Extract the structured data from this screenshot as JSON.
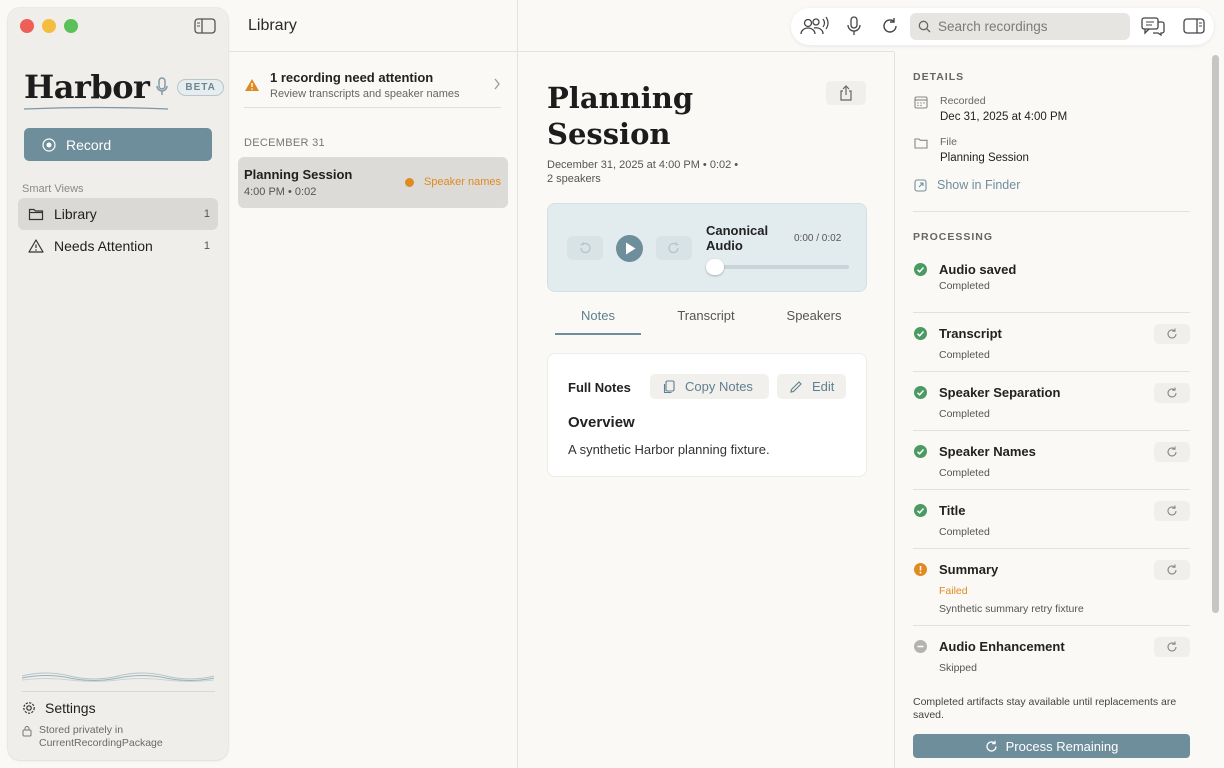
{
  "window": {
    "colors": {
      "accent": "#6f8e9c",
      "warning": "#e08a22",
      "success": "#4a9a62"
    }
  },
  "sidebar": {
    "brand": "Harbor",
    "beta": "BETA",
    "record_label": "Record",
    "section_label": "Smart Views",
    "items": [
      {
        "label": "Library",
        "count": "1",
        "icon": "folder-icon"
      },
      {
        "label": "Needs Attention",
        "count": "1",
        "icon": "warning-triangle-icon"
      }
    ],
    "settings_label": "Settings",
    "stored_line1": "Stored privately in",
    "stored_line2": "CurrentRecordingPackage"
  },
  "list": {
    "title": "Library",
    "alert_title": "1 recording need attention",
    "alert_sub": "Review transcripts and speaker names",
    "date_heading": "DECEMBER 31",
    "recording": {
      "title": "Planning Session",
      "meta": "4:00 PM  •  0:02",
      "badge": "Speaker names"
    }
  },
  "toolbar": {
    "search_placeholder": "Search recordings"
  },
  "detail": {
    "title": "Planning Session",
    "meta_line1": "December 31, 2025 at 4:00 PM  •  0:02  •",
    "meta_line2": "2 speakers",
    "player": {
      "title": "Canonical Audio",
      "time": "0:00 / 0:02",
      "progress": 0
    },
    "tabs": [
      "Notes",
      "Transcript",
      "Speakers"
    ],
    "active_tab": "Notes",
    "notes": {
      "heading": "Full Notes",
      "copy_label": "Copy Notes",
      "edit_label": "Edit",
      "overview_heading": "Overview",
      "overview_text": "A synthetic Harbor planning fixture."
    }
  },
  "panel": {
    "details_label": "DETAILS",
    "recorded_label": "Recorded",
    "recorded_value": "Dec 31, 2025 at 4:00 PM",
    "file_label": "File",
    "file_value": "Planning Session",
    "finder_label": "Show in Finder",
    "processing_label": "PROCESSING",
    "steps": [
      {
        "name": "Audio saved",
        "state": "Completed",
        "status": "ok"
      },
      {
        "name": "Transcript",
        "state": "Completed",
        "status": "ok"
      },
      {
        "name": "Speaker Separation",
        "state": "Completed",
        "status": "ok"
      },
      {
        "name": "Speaker Names",
        "state": "Completed",
        "status": "ok"
      },
      {
        "name": "Title",
        "state": "Completed",
        "status": "ok"
      },
      {
        "name": "Summary",
        "state": "Failed",
        "detail": "Synthetic summary retry fixture",
        "status": "failed"
      },
      {
        "name": "Audio Enhancement",
        "state": "Skipped",
        "status": "skipped"
      }
    ],
    "footnote": "Completed artifacts stay available until replacements are saved.",
    "process_label": "Process Remaining"
  }
}
